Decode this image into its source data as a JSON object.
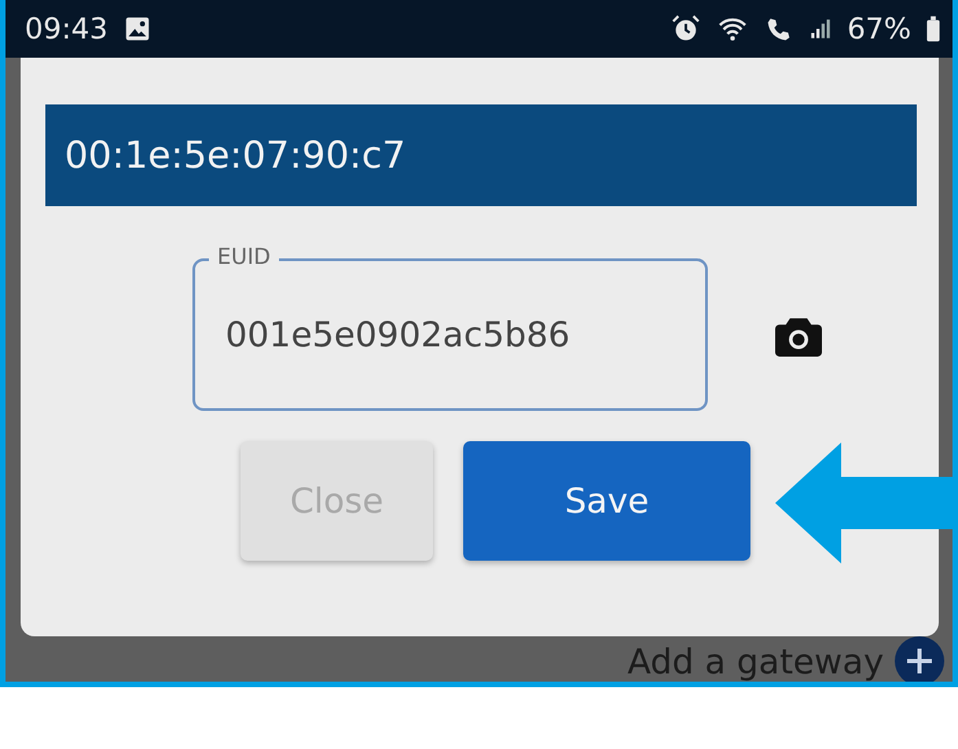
{
  "status_bar": {
    "time": "09:43",
    "battery": "67%"
  },
  "dialog": {
    "title": "00:1e:5e:07:90:c7",
    "field": {
      "label": "EUID",
      "value": "001e5e0902ac5b86"
    },
    "buttons": [
      {
        "label": "Close",
        "kind": "secondary",
        "disabled": true
      },
      {
        "label": "Save",
        "kind": "primary",
        "disabled": false
      }
    ]
  },
  "footer": {
    "action": "Add a gateway"
  }
}
